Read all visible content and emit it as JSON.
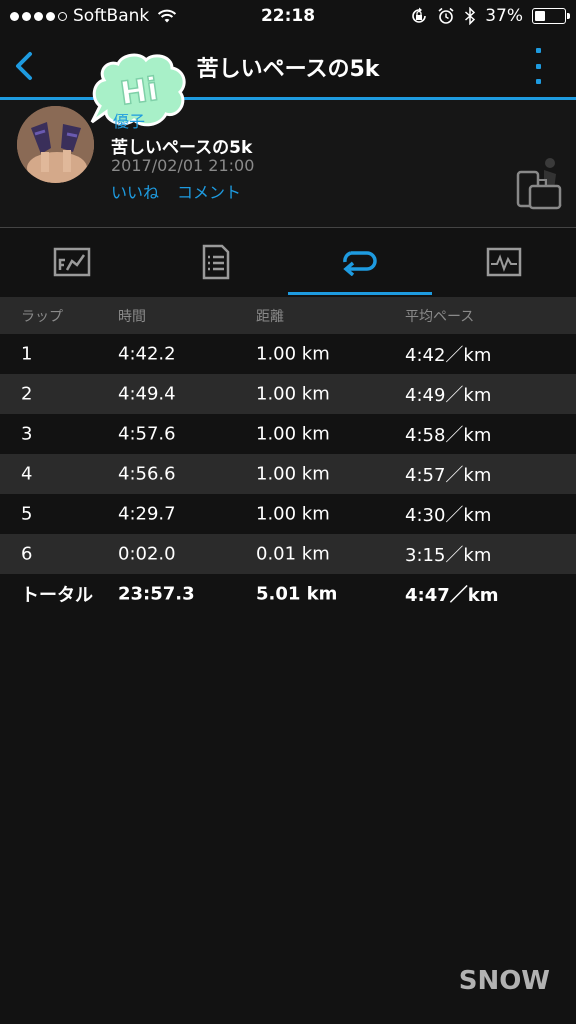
{
  "status_bar": {
    "signal_dots": [
      true,
      true,
      true,
      true,
      false
    ],
    "carrier": "SoftBank",
    "time": "22:18",
    "battery_percent": "37%",
    "battery_level": 0.37
  },
  "nav": {
    "title": "苦しいペースの5k",
    "back_icon": "chevron-left-icon",
    "more_icon": "more-vertical-icon",
    "accent": "#1e9be0"
  },
  "header": {
    "owner_name": "優子",
    "activity_title": "苦しいペースの5k",
    "date": "2017/02/01 21:00",
    "like_label": "いいね",
    "comment_label": "コメント",
    "sticker_text": "Hi",
    "share_icon": "share-screen-icon"
  },
  "tabs": [
    {
      "icon": "chart-icon",
      "active": false
    },
    {
      "icon": "document-list-icon",
      "active": false
    },
    {
      "icon": "laps-icon",
      "active": true
    },
    {
      "icon": "activity-graph-icon",
      "active": false
    }
  ],
  "laps": {
    "columns": [
      "ラップ",
      "時間",
      "距離",
      "平均ペース"
    ],
    "rows": [
      [
        "1",
        "4:42.2",
        "1.00 km",
        "4:42／km"
      ],
      [
        "2",
        "4:49.4",
        "1.00 km",
        "4:49／km"
      ],
      [
        "3",
        "4:57.6",
        "1.00 km",
        "4:58／km"
      ],
      [
        "4",
        "4:56.6",
        "1.00 km",
        "4:57／km"
      ],
      [
        "5",
        "4:29.7",
        "1.00 km",
        "4:30／km"
      ],
      [
        "6",
        "0:02.0",
        "0.01 km",
        "3:15／km"
      ]
    ],
    "total": [
      "トータル",
      "23:57.3",
      "5.01 km",
      "4:47／km"
    ]
  },
  "watermark": "SNOW"
}
